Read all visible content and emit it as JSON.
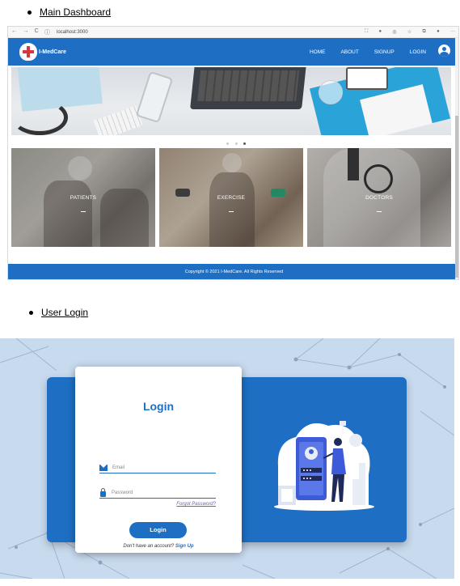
{
  "headings": {
    "dashboard": "Main Dashboard",
    "login": "User Login"
  },
  "browser": {
    "url": "localhost:3000",
    "nav_back": "←",
    "nav_forward": "→",
    "nav_refresh": "C",
    "nav_info": "ⓘ"
  },
  "app": {
    "brand": "I-MedCare",
    "nav": [
      "HOME",
      "ABOUT",
      "SIGNUP",
      "LOGIN"
    ],
    "cards": [
      "PATIENTS",
      "EXERCISE",
      "DOCTORS"
    ],
    "footer": "Copyright © 2021 I-MedCare. All Rights Reserved"
  },
  "login": {
    "title": "Login",
    "email_placeholder": "Email",
    "password_placeholder": "Password",
    "forgot": "Forgot Password?",
    "button": "Login",
    "signup_prompt": "Don't have an account?",
    "signup_link": "Sign Up"
  },
  "colors": {
    "primary": "#1e6fc4",
    "background": "#c8daee"
  }
}
